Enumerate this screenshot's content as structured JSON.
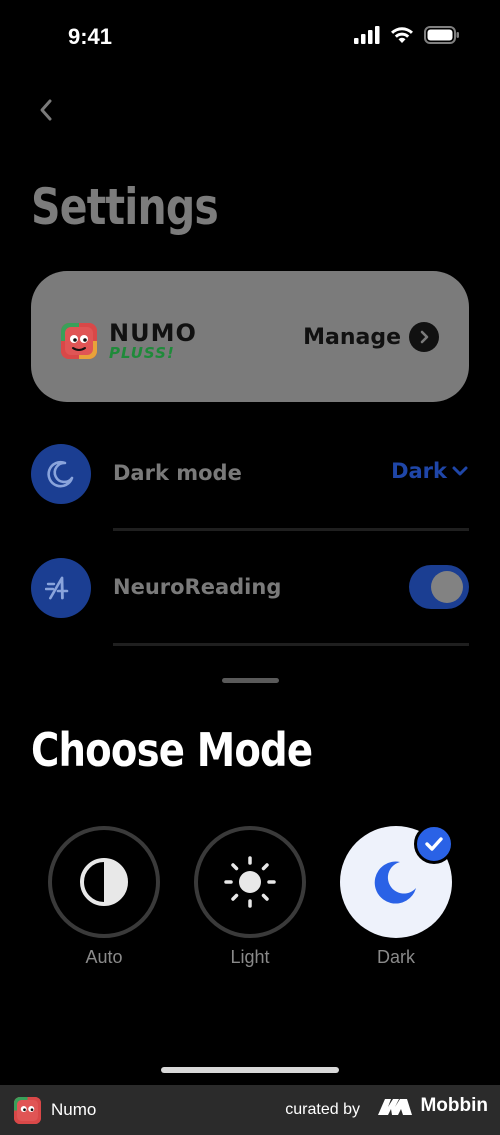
{
  "status_bar": {
    "time": "9:41",
    "icons": [
      "cellular-signal-icon",
      "wifi-icon",
      "battery-icon"
    ]
  },
  "header": {
    "back_icon": "chevron-left-icon",
    "title": "Settings"
  },
  "plus_card": {
    "brand_line1": "NUMO",
    "brand_line2": "PLUSS!",
    "manage_label": "Manage",
    "manage_icon": "chevron-right-circle-icon"
  },
  "settings_rows": {
    "dark_mode": {
      "icon": "moon-icon",
      "label": "Dark mode",
      "value": "Dark",
      "value_icon": "chevron-down-icon"
    },
    "neuro_reading": {
      "icon": "neuroreading-icon",
      "label": "NeuroReading",
      "toggle_on": true
    }
  },
  "mode_sheet": {
    "title": "Choose Mode",
    "options": [
      {
        "label": "Auto",
        "icon": "half-circle-icon",
        "selected": false
      },
      {
        "label": "Light",
        "icon": "sun-icon",
        "selected": false
      },
      {
        "label": "Dark",
        "icon": "moon-icon",
        "selected": true
      }
    ]
  },
  "footer": {
    "app_name": "Numo",
    "curated_by": "curated by",
    "brand": "Mobbin"
  },
  "colors": {
    "accent_blue": "#2a62e6",
    "row_icon_bg": "#1b3e92",
    "card_bg": "#7b7b7b",
    "background": "#000000"
  }
}
